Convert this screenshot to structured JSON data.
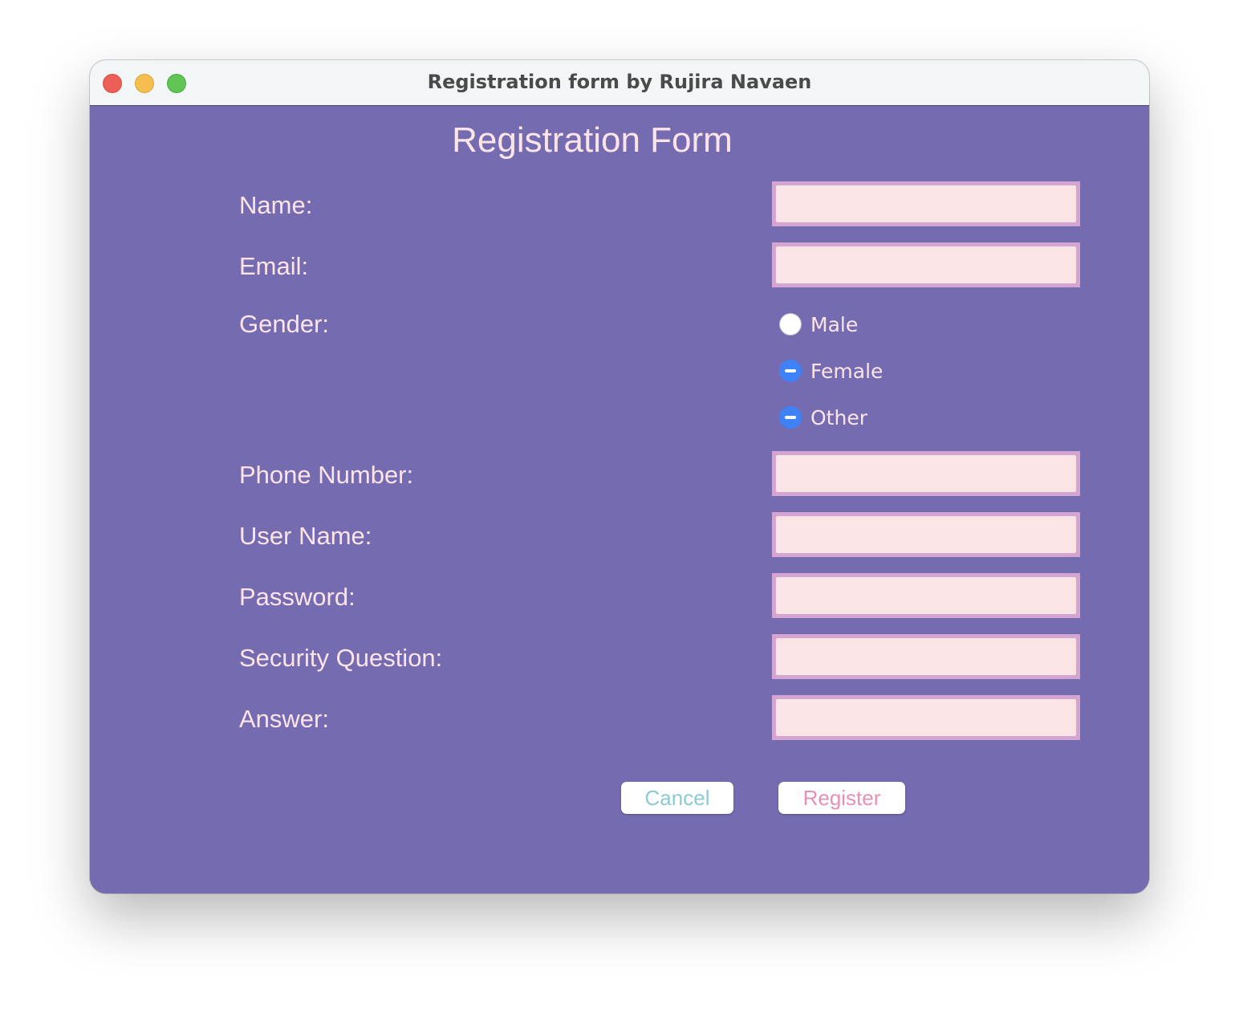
{
  "window": {
    "title": "Registration form by Rujira Navaen"
  },
  "form": {
    "heading": "Registration Form",
    "fields": {
      "name": {
        "label": "Name:",
        "value": ""
      },
      "email": {
        "label": "Email:",
        "value": ""
      },
      "phone": {
        "label": "Phone Number:",
        "value": ""
      },
      "username": {
        "label": "User Name:",
        "value": ""
      },
      "password": {
        "label": "Password:",
        "value": ""
      },
      "security_question": {
        "label": "Security Question:",
        "value": ""
      },
      "answer": {
        "label": "Answer:",
        "value": ""
      }
    },
    "gender": {
      "label": "Gender:",
      "options": [
        {
          "label": "Male",
          "state": "unselected"
        },
        {
          "label": "Female",
          "state": "mixed"
        },
        {
          "label": "Other",
          "state": "mixed"
        }
      ]
    },
    "buttons": {
      "cancel": "Cancel",
      "register": "Register"
    }
  },
  "colors": {
    "background": "#756bb1",
    "label_text": "#fbe4e8",
    "field_border": "#d4a5d0",
    "field_fill": "#fae4e5",
    "cancel_text": "#8ccad3",
    "register_text": "#e88fb6",
    "radio_accent": "#3d82f6"
  },
  "icons": {
    "close": "close-traffic-light",
    "minimize": "minimize-traffic-light",
    "zoom": "zoom-traffic-light"
  }
}
